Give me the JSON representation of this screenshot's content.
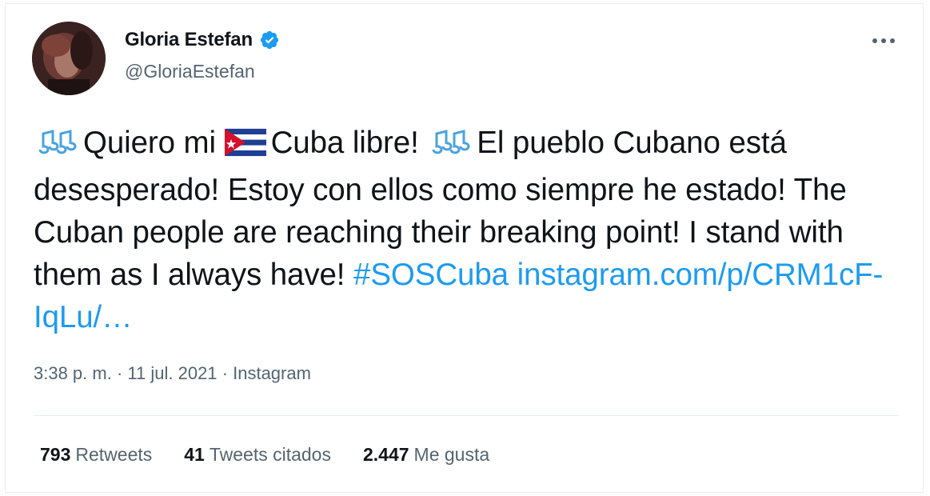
{
  "tweet": {
    "author": {
      "display_name": "Gloria Estefan",
      "handle": "@GloriaEstefan",
      "verified": true
    },
    "text": {
      "part1": "Quiero mi",
      "part2": "Cuba libre!",
      "part3": "El pueblo Cubano está desesperado! Estoy con ellos como siempre he estado! The Cuban people are reaching their breaking point! I stand with them as I always have!",
      "hashtag": "#SOSCuba",
      "link": "instagram.com/p/CRM1cF-IqLu/…"
    },
    "meta": {
      "time": "3:38 p. m.",
      "separator": " · ",
      "date": "11 jul. 2021",
      "source": "Instagram"
    },
    "stats": {
      "retweets": {
        "count": "793",
        "label": "Retweets"
      },
      "quotes": {
        "count": "41",
        "label": "Tweets citados"
      },
      "likes": {
        "count": "2.447",
        "label": "Me gusta"
      }
    }
  },
  "colors": {
    "link": "#1d9bf0",
    "secondary_text": "#536471",
    "verified": "#1d9bf0"
  },
  "icons": [
    "avatar",
    "verified-badge-icon",
    "more-options-icon",
    "musical-notes-emoji",
    "cuba-flag-emoji"
  ]
}
